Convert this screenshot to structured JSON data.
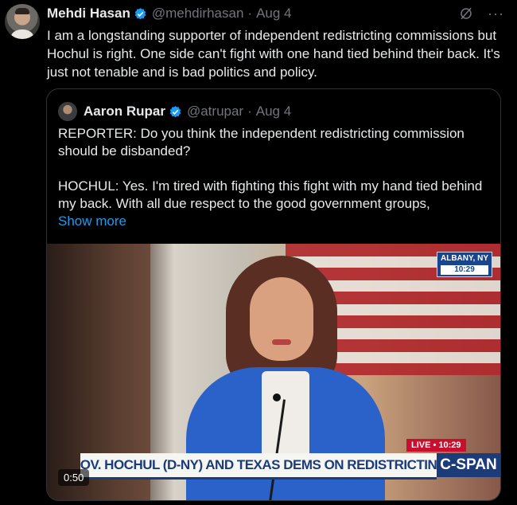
{
  "tweet": {
    "author_name": "Mehdi Hasan",
    "handle": "@mehdirhasan",
    "separator": "·",
    "date": "Aug 4",
    "text": "I am a longstanding supporter of independent redistricting commissions but Hochul is right. One side can't fight with one hand tied behind their back. It's just not tenable and is bad politics and policy."
  },
  "top_actions": {
    "more_label": "···",
    "grok_icon": "grok-icon"
  },
  "quoted": {
    "author_name": "Aaron Rupar",
    "handle": "@atrupar",
    "separator": "·",
    "date": "Aug 4",
    "line1": "REPORTER: Do you think the independent redistricting commission should be disbanded?",
    "line2": "HOCHUL: Yes. I'm tired with fighting this fight with my hand tied behind my back. With all due respect to the good government groups,",
    "show_more": "Show more"
  },
  "video": {
    "location": "ALBANY, NY",
    "location_time": "10:29",
    "live_label": "LIVE • 10:29",
    "chyron": "GOV. HOCHUL (D-NY) AND TEXAS DEMS ON REDISTRICTING",
    "network": "C-SPAN",
    "duration": "0:50"
  },
  "colors": {
    "accent": "#1d9bf0",
    "verified": "#1d9bf0",
    "background": "#000000"
  }
}
